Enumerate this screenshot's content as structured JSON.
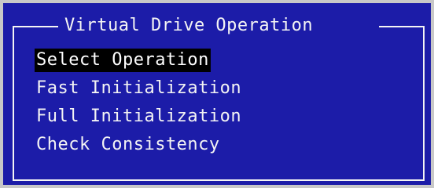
{
  "dialog": {
    "title": "Virtual Drive Operation",
    "items": [
      {
        "label": "Select Operation",
        "selected": true
      },
      {
        "label": "Fast Initialization",
        "selected": false
      },
      {
        "label": "Full Initialization",
        "selected": false
      },
      {
        "label": "Check Consistency",
        "selected": false
      }
    ]
  },
  "colors": {
    "background": "#1c1ca8",
    "foreground": "#f4f4f4",
    "highlight": "#000000"
  }
}
